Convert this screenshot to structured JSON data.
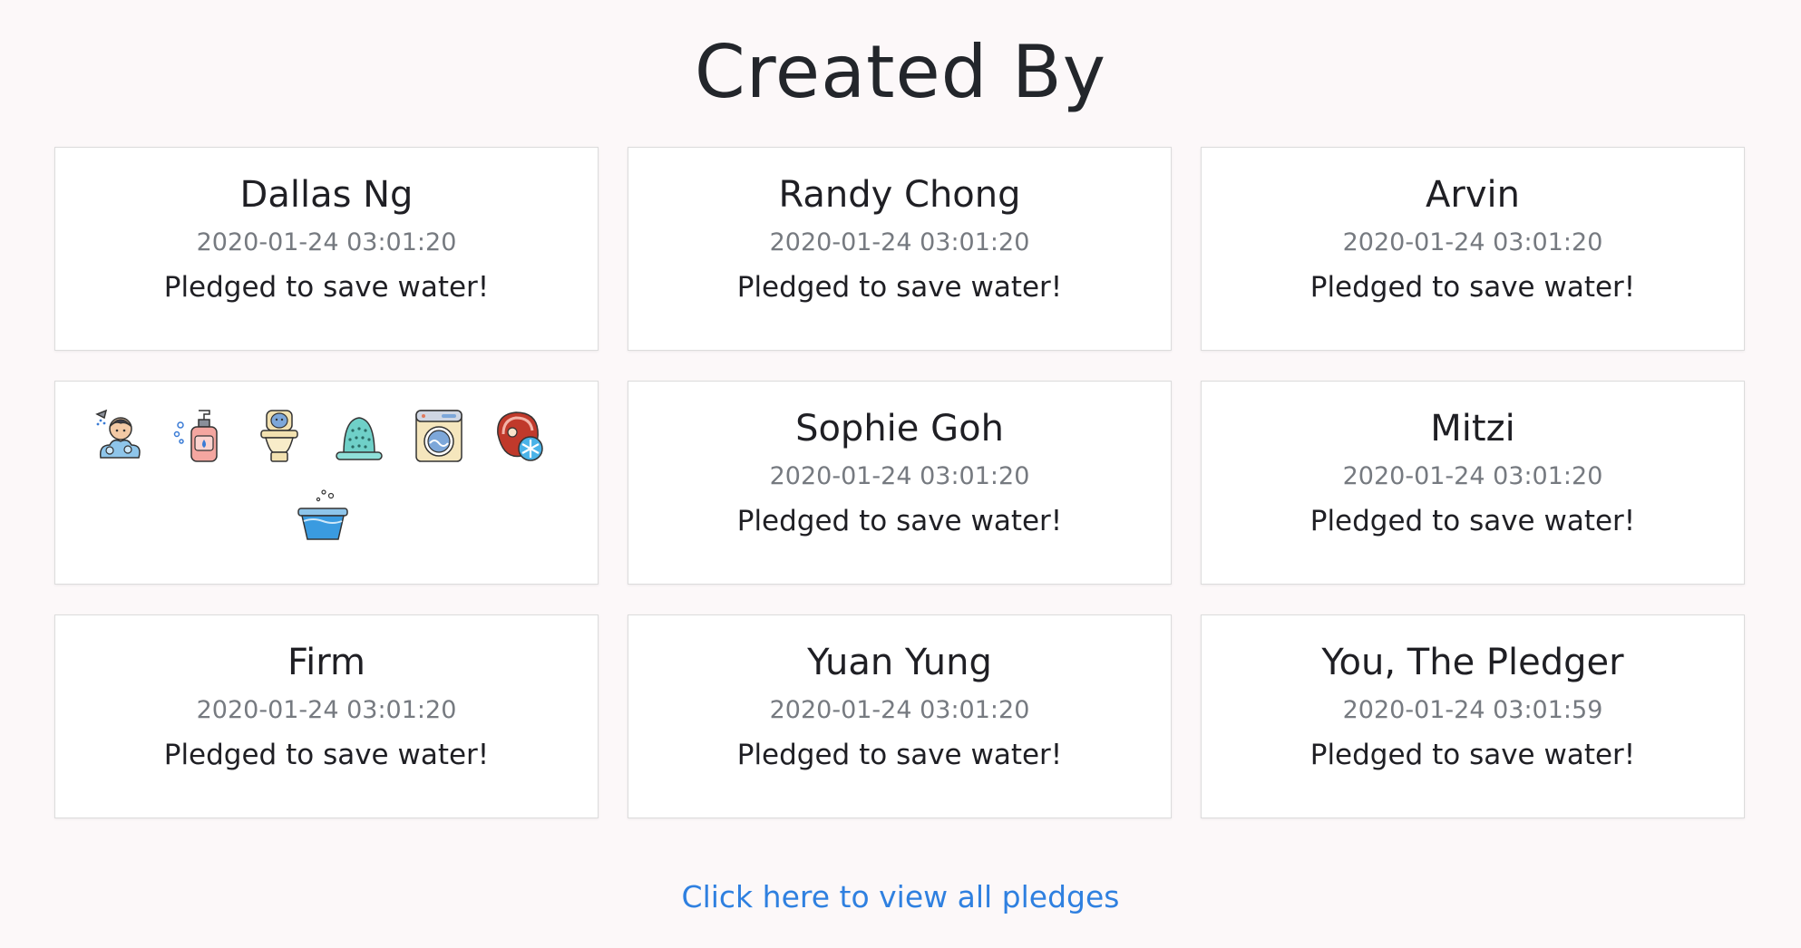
{
  "page": {
    "title": "Created By",
    "footer_link": "Click here to view all pledges"
  },
  "cards": [
    {
      "name": "Dallas Ng",
      "date": "2020-01-24 03:01:20",
      "message": "Pledged to save water!"
    },
    {
      "name": "Randy Chong",
      "date": "2020-01-24 03:01:20",
      "message": "Pledged to save water!"
    },
    {
      "name": "Arvin",
      "date": "2020-01-24 03:01:20",
      "message": "Pledged to save water!"
    },
    {
      "name": "Sophie Goh",
      "date": "2020-01-24 03:01:20",
      "message": "Pledged to save water!"
    },
    {
      "name": "Mitzi",
      "date": "2020-01-24 03:01:20",
      "message": "Pledged to save water!"
    },
    {
      "name": "Firm",
      "date": "2020-01-24 03:01:20",
      "message": "Pledged to save water!"
    },
    {
      "name": "Yuan Yung",
      "date": "2020-01-24 03:01:20",
      "message": "Pledged to save water!"
    },
    {
      "name": "You, The Pledger",
      "date": "2020-01-24 03:01:59",
      "message": "Pledged to save water!"
    }
  ],
  "icons": [
    "shower-icon",
    "soap-dispenser-icon",
    "toilet-icon",
    "thimble-icon",
    "washing-machine-icon",
    "frozen-meat-icon",
    "water-basin-icon"
  ],
  "colors": {
    "background": "#fcf8f9",
    "card_border": "#dcdcdc",
    "link": "#2f80e0",
    "date_text": "#767a80"
  }
}
